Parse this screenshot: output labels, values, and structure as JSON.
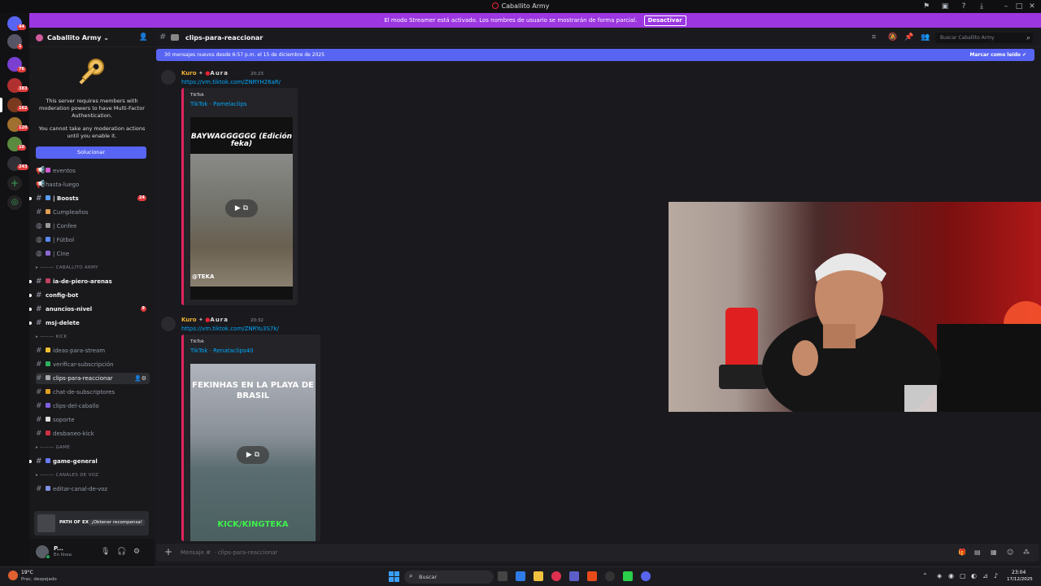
{
  "window": {
    "title": "Caballito Army",
    "controls": [
      "minimize",
      "maximize",
      "close"
    ]
  },
  "streamer_banner": {
    "text": "El modo Streamer está activado. Los nombres de usuario se mostrarán de forma parcial.",
    "button": "Desactivar"
  },
  "server_rail": {
    "badges": [
      "44",
      "1",
      "76",
      "383",
      "162",
      "120",
      "10",
      "243"
    ]
  },
  "sidebar": {
    "server_name": "Caballito Army",
    "mfa_notice": {
      "line1": "This server requires members with moderation powers to have Multi-Factor Authentication.",
      "line2": "You cannot take any moderation actions until you enable it.",
      "button": "Solucionar"
    },
    "channels_top": [
      {
        "name": "eventos",
        "type": "announce",
        "emoji_color": "#d05ad0"
      },
      {
        "name": "hasta-luego",
        "type": "announce"
      },
      {
        "name": "| Boosts",
        "type": "text",
        "unread": true,
        "emoji_color": "#5aa0ff",
        "badge": "24"
      },
      {
        "name": "Cumpleaños",
        "type": "text",
        "emoji_color": "#e0a050"
      },
      {
        "name": "| Confee",
        "type": "forum",
        "emoji_color": "#999"
      },
      {
        "name": "| Fútbol",
        "type": "forum",
        "emoji_color": "#5a8aff"
      },
      {
        "name": "| Cine",
        "type": "forum",
        "emoji_color": "#8a6ad0"
      }
    ],
    "category1": "CABALLITO ARMY",
    "channels_army": [
      {
        "name": "ia-de-piero-arenas",
        "unread": true,
        "emoji_color": "#c04060"
      },
      {
        "name": "config-bot",
        "unread": true
      },
      {
        "name": "anuncios-nivel",
        "unread": true,
        "badge": "9"
      },
      {
        "name": "msj-delete",
        "unread": true
      }
    ],
    "category2": "KICK",
    "channels_kick": [
      {
        "name": "ideas-para-stream",
        "emoji_color": "#f0c030"
      },
      {
        "name": "verificar-subscripción",
        "emoji_color": "#30b060"
      },
      {
        "name": "clips-para-reaccionar",
        "active": true,
        "emoji_color": "#aaa"
      },
      {
        "name": "chat-de-subscriptores",
        "emoji_color": "#e0a020"
      },
      {
        "name": "clips-del-caballo",
        "emoji_color": "#8060e0"
      },
      {
        "name": "soporte",
        "emoji_color": "#ddd"
      },
      {
        "name": "desbaneo-kick",
        "emoji_color": "#d03040"
      }
    ],
    "category3": "GAME",
    "channels_game": [
      {
        "name": "game-general",
        "unread": true,
        "emoji_color": "#6a7aff"
      }
    ],
    "category4": "CANALES DE VOZ",
    "channels_voice": [
      {
        "name": "editar-canal-de-voz",
        "emoji_color": "#8090e0"
      }
    ],
    "promo": {
      "title": "PATH OF EXILE II",
      "button": "¡Obtener recompensa!"
    },
    "user": {
      "name": "P...",
      "status": "En línea"
    }
  },
  "main": {
    "channel_name": "clips-para-reaccionar",
    "search_placeholder": "Buscar Caballito Army",
    "new_messages": {
      "text": "30 mensajes nuevos desde 6:57 p.m. el 15 de diciembre de 2025",
      "mark_read": "Marcar como leído"
    },
    "messages": [
      {
        "author": "Kuro",
        "tag": "Aura",
        "time": "20:23",
        "link": "https://vm.tiktok.com/ZNRYH26aR/",
        "embed": {
          "provider": "TikTok",
          "title": "TikTok · Pamelaclips",
          "caption_top": "BAYWAGGGGGG (Edición feka)",
          "caption_bottom": "@TEKA"
        }
      },
      {
        "author": "Kuro",
        "tag": "Aura",
        "time": "20:32",
        "link": "https://vm.tiktok.com/ZNRYu3S7k/",
        "embed": {
          "provider": "TikTok",
          "title": "TikTok · Renataclips40",
          "caption_top": "FEKINHAS EN LA PLAYA DE BRASIL",
          "caption_bottom": "KICK/KINGTEKA"
        }
      }
    ],
    "composer_placeholder": "Mensaje #  · clips-para-reaccionar"
  },
  "taskbar": {
    "weather_temp": "19°C",
    "weather_desc": "Prac. despejado",
    "search": "Buscar",
    "time": "23:04",
    "date": "17/12/2025"
  },
  "colors": {
    "brand": "#5865f2",
    "streamer_banner": "#9b36e0",
    "link": "#00a8fc",
    "badge": "#e23b3b"
  }
}
